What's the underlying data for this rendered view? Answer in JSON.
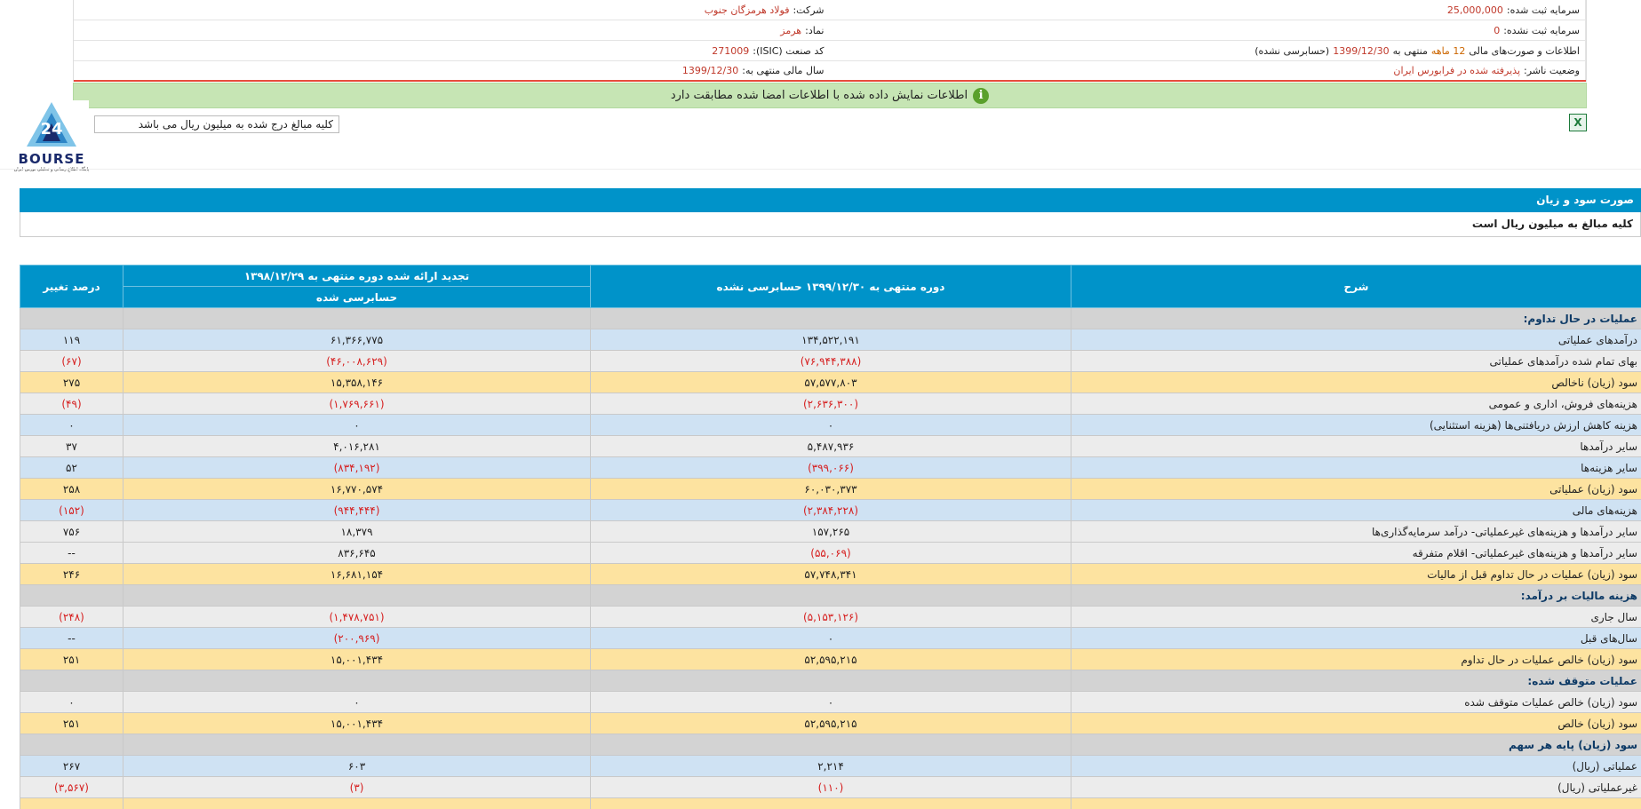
{
  "header": {
    "company_label": "شرکت:",
    "company_value": "فولاد هرمزگان جنوب",
    "symbol_label": "نماد:",
    "symbol_value": "هرمز",
    "isic_label": "کد صنعت (ISIC):",
    "isic_value": "271009",
    "fiscal_year_label": "سال مالی منتهی به:",
    "fiscal_year_value": "1399/12/30",
    "registered_capital_label": "سرمایه ثبت شده:",
    "registered_capital_value": "25,000,000",
    "unregistered_capital_label": "سرمایه ثبت نشده:",
    "unregistered_capital_value": "0",
    "statements_label": "اطلاعات و صورت‌های مالی",
    "statements_period": "12 ماهه",
    "statements_mid": "منتهی به",
    "statements_date": "1399/12/30",
    "statements_status": "(حسابرسی نشده)",
    "publisher_label": "وضعیت ناشر:",
    "publisher_value": "پذیرفته شده در فرابورس ایران"
  },
  "notice": {
    "text": "اطلاعات نمایش داده شده با اطلاعات امضا شده مطابقت دارد",
    "icon": "info-icon"
  },
  "amount_box_text": "کلیه مبالغ درج شده به میلیون ریال می باشد",
  "logo": {
    "brand": "BOURSE",
    "tagline": "پایگاه اطلاع رسانی و تحلیلی بورس ایران",
    "number": "24"
  },
  "section": {
    "title": "صورت سود و زیان",
    "subtitle": "کلیه مبالغ به میلیون ریال است"
  },
  "table": {
    "col_desc": "شرح",
    "col_current": "دوره منتهی به ۱۳۹۹/۱۲/۳۰ حسابرسی نشده",
    "col_prev": "تجدید ارائه شده دوره منتهی به ۱۳۹۸/۱۲/۲۹",
    "col_prev_sub": "حسابرسی شده",
    "col_change": "درصد تغییر",
    "rows": [
      {
        "type": "section",
        "desc": "عملیات در حال تداوم:",
        "cur": "",
        "prev": "",
        "chg": ""
      },
      {
        "type": "blue",
        "desc": "درآمدهای عملیاتی",
        "cur": "۱۳۴,۵۲۲,۱۹۱",
        "prev": "۶۱,۳۶۶,۷۷۵",
        "chg": "۱۱۹"
      },
      {
        "type": "gray",
        "desc": "بهای تمام شده درآمدهای عملیاتی",
        "cur": "(۷۶,۹۴۴,۳۸۸)",
        "prev": "(۴۶,۰۰۸,۶۲۹)",
        "chg": "(۶۷)"
      },
      {
        "type": "yellow",
        "desc": "سود (زیان) ناخالص",
        "cur": "۵۷,۵۷۷,۸۰۳",
        "prev": "۱۵,۳۵۸,۱۴۶",
        "chg": "۲۷۵"
      },
      {
        "type": "gray",
        "desc": "هزینه‌های فروش، اداری و عمومی",
        "cur": "(۲,۶۳۶,۳۰۰)",
        "prev": "(۱,۷۶۹,۶۶۱)",
        "chg": "(۴۹)"
      },
      {
        "type": "blue",
        "desc": "هزینه کاهش ارزش دریافتنی‌ها (هزینه استثنایی)",
        "cur": "۰",
        "prev": "۰",
        "chg": "۰"
      },
      {
        "type": "gray",
        "desc": "سایر درآمدها",
        "cur": "۵,۴۸۷,۹۳۶",
        "prev": "۴,۰۱۶,۲۸۱",
        "chg": "۳۷"
      },
      {
        "type": "blue",
        "desc": "سایر هزینه‌ها",
        "cur": "(۳۹۹,۰۶۶)",
        "prev": "(۸۳۴,۱۹۲)",
        "chg": "۵۲"
      },
      {
        "type": "yellow",
        "desc": "سود (زیان) عملیاتی",
        "cur": "۶۰,۰۳۰,۳۷۳",
        "prev": "۱۶,۷۷۰,۵۷۴",
        "chg": "۲۵۸"
      },
      {
        "type": "blue",
        "desc": "هزینه‌های مالی",
        "cur": "(۲,۳۸۴,۲۲۸)",
        "prev": "(۹۴۴,۴۴۴)",
        "chg": "(۱۵۲)"
      },
      {
        "type": "gray",
        "desc": "سایر درآمدها و هزینه‌های غیرعملیاتی- درآمد سرمایه‌گذاری‌ها",
        "cur": "۱۵۷,۲۶۵",
        "prev": "۱۸,۳۷۹",
        "chg": "۷۵۶"
      },
      {
        "type": "gray",
        "desc": "سایر درآمدها و هزینه‌های غیرعملیاتی- اقلام متفرقه",
        "cur": "(۵۵,۰۶۹)",
        "prev": "۸۳۶,۶۴۵",
        "chg": "--"
      },
      {
        "type": "yellow",
        "desc": "سود (زیان) عملیات در حال تداوم قبل از مالیات",
        "cur": "۵۷,۷۴۸,۳۴۱",
        "prev": "۱۶,۶۸۱,۱۵۴",
        "chg": "۲۴۶"
      },
      {
        "type": "section",
        "desc": "هزینه مالیات بر درآمد:",
        "cur": "",
        "prev": "",
        "chg": ""
      },
      {
        "type": "gray",
        "desc": "سال جاری",
        "cur": "(۵,۱۵۳,۱۲۶)",
        "prev": "(۱,۴۷۸,۷۵۱)",
        "chg": "(۲۴۸)"
      },
      {
        "type": "blue",
        "desc": "سال‌های قبل",
        "cur": "۰",
        "prev": "(۲۰۰,۹۶۹)",
        "chg": "--"
      },
      {
        "type": "yellow",
        "desc": "سود (زیان) خالص عملیات در حال تداوم",
        "cur": "۵۲,۵۹۵,۲۱۵",
        "prev": "۱۵,۰۰۱,۴۳۴",
        "chg": "۲۵۱"
      },
      {
        "type": "section",
        "desc": "عملیات متوقف شده:",
        "cur": "",
        "prev": "",
        "chg": ""
      },
      {
        "type": "gray",
        "desc": "سود (زیان) خالص عملیات متوقف شده",
        "cur": "۰",
        "prev": "۰",
        "chg": "۰"
      },
      {
        "type": "yellow",
        "desc": "سود (زیان) خالص",
        "cur": "۵۲,۵۹۵,۲۱۵",
        "prev": "۱۵,۰۰۱,۴۳۴",
        "chg": "۲۵۱"
      },
      {
        "type": "section",
        "desc": "سود (زیان) پایه هر سهم",
        "cur": "",
        "prev": "",
        "chg": ""
      },
      {
        "type": "blue",
        "desc": "عملیاتی (ریال)",
        "cur": "۲,۲۱۴",
        "prev": "۶۰۳",
        "chg": "۲۶۷"
      },
      {
        "type": "gray",
        "desc": "غیرعملیاتی (ریال)",
        "cur": "(۱۱۰)",
        "prev": "(۳)",
        "chg": "(۳,۵۶۷)"
      },
      {
        "type": "yellow",
        "desc": "",
        "cur": "",
        "prev": "",
        "chg": ""
      }
    ]
  },
  "colors": {
    "header_blue": "#0093c9",
    "row_blue": "#cfe2f3",
    "row_gray": "#ececec",
    "row_yellow": "#fde3a0",
    "row_section": "#d3d3d3",
    "negative": "#d61f1f",
    "notice_green": "#c6e5b4"
  }
}
